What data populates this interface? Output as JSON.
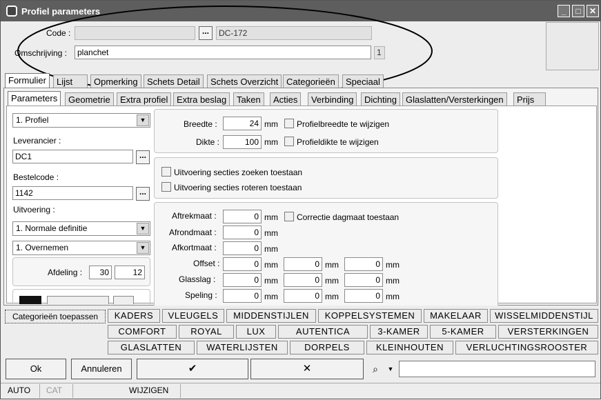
{
  "window": {
    "title": "Profiel parameters"
  },
  "header": {
    "code_label": "Code :",
    "code_value": "",
    "code_btn": "...",
    "code_display": "DC-172",
    "omschrijving_label": "Omschrijving :",
    "omschrijving_value": "planchet",
    "omschrijving_count": "1"
  },
  "main_tabs": [
    "Formulier",
    "Lijst",
    "Opmerking",
    "Schets Detail",
    "Schets Overzicht",
    "Categorieën",
    "Speciaal"
  ],
  "sub_tabs": [
    "Parameters",
    "Geometrie",
    "Extra profiel",
    "Extra beslag",
    "Taken",
    "Acties",
    "Verbinding",
    "Dichting",
    "Glaslatten/Versterkingen",
    "Prijs"
  ],
  "left": {
    "type_select": "1. Profiel",
    "leverancier_label": "Leverancier :",
    "leverancier_value": "DC1",
    "bestelcode_label": "Bestelcode :",
    "bestelcode_value": "1142",
    "uitvoering_label": "Uitvoering :",
    "uitvoering_select1": "1. Normale definitie",
    "uitvoering_select2": "1. Overnemen",
    "afdeling_label": "Afdeling :",
    "afdeling_value1": "30",
    "afdeling_value2": "12",
    "dots": "..."
  },
  "dims": {
    "breedte_label": "Breedte :",
    "breedte_value": "24",
    "breedte_unit": "mm",
    "breedte_check": "Profielbreedte te wijzigen",
    "dikte_label": "Dikte :",
    "dikte_value": "100",
    "dikte_unit": "mm",
    "dikte_check": "Profieldikte te wijzigen"
  },
  "secties": {
    "zoeken": "Uitvoering secties zoeken toestaan",
    "roteren": "Uitvoering secties roteren toestaan"
  },
  "measure": {
    "unit": "mm",
    "correctie": "Correctie dagmaat toestaan",
    "rows": [
      {
        "label": "Aftrekmaat :",
        "values": [
          "0"
        ]
      },
      {
        "label": "Afrondmaat :",
        "values": [
          "0"
        ]
      },
      {
        "label": "Afkortmaat :",
        "values": [
          "0"
        ]
      },
      {
        "label": "Offset :",
        "values": [
          "0",
          "0",
          "0"
        ]
      },
      {
        "label": "Glasslag :",
        "values": [
          "0",
          "0",
          "0"
        ]
      },
      {
        "label": "Speling :",
        "values": [
          "0",
          "0",
          "0"
        ]
      }
    ]
  },
  "categories": {
    "apply_btn": "Categorieën toepassen",
    "row1": [
      "KADERS",
      "VLEUGELS",
      "MIDDENSTIJLEN",
      "KOPPELSYSTEMEN",
      "MAKELAAR",
      "WISSELMIDDENSTIJL"
    ],
    "row2": [
      "COMFORT",
      "ROYAL",
      "LUX",
      "AUTENTICA",
      "3-KAMER",
      "5-KAMER",
      "VERSTERKINGEN"
    ],
    "row3": [
      "GLASLATTEN",
      "WATERLIJSTEN",
      "DORPELS",
      "KLEINHOUTEN",
      "VERLUCHTINGSROOSTER"
    ]
  },
  "buttons": {
    "ok": "Ok",
    "annuleren": "Annuleren",
    "confirm": "✔",
    "cancel": "✕"
  },
  "status": {
    "mode": "AUTO",
    "cat": "CAT",
    "state": "WIJZIGEN"
  }
}
